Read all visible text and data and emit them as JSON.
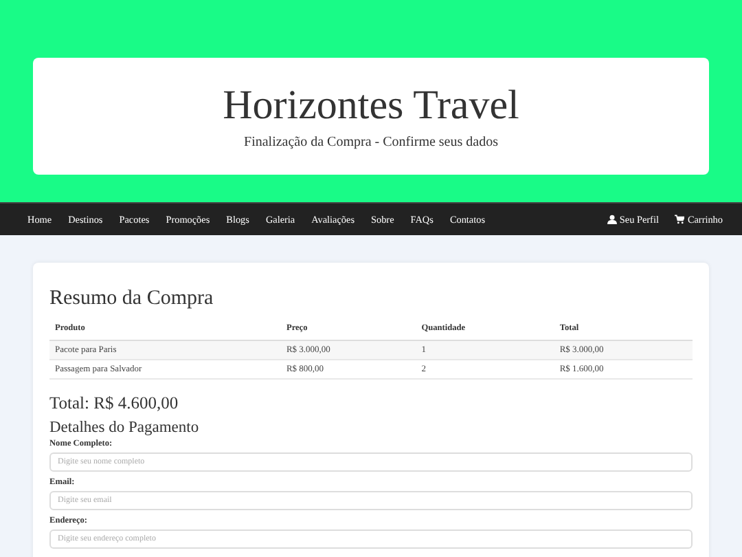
{
  "header": {
    "title": "Horizontes Travel",
    "subtitle": "Finalização da Compra - Confirme seus dados"
  },
  "nav": {
    "links": [
      "Home",
      "Destinos",
      "Pacotes",
      "Promoções",
      "Blogs",
      "Galeria",
      "Avaliações",
      "Sobre",
      "FAQs",
      "Contatos"
    ],
    "right": [
      {
        "kind": "user",
        "label": "Seu Perfil"
      },
      {
        "kind": "cart",
        "label": "Carrinho"
      }
    ]
  },
  "summary": {
    "title": "Resumo da Compra",
    "columns": [
      "Produto",
      "Preço",
      "Quantidade",
      "Total"
    ],
    "rows": [
      [
        "Pacote para Paris",
        "R$ 3.000,00",
        "1",
        "R$ 3.000,00"
      ],
      [
        "Passagem para Salvador",
        "R$ 800,00",
        "2",
        "R$ 1.600,00"
      ]
    ],
    "total": "Total: R$ 4.600,00"
  },
  "payment": {
    "title": "Detalhes do Pagamento",
    "fields": [
      {
        "label": "Nome Completo:",
        "placeholder": "Digite seu nome completo"
      },
      {
        "label": "Email:",
        "placeholder": "Digite seu email"
      },
      {
        "label": "Endereço:",
        "placeholder": "Digite seu endereço completo"
      }
    ]
  }
}
